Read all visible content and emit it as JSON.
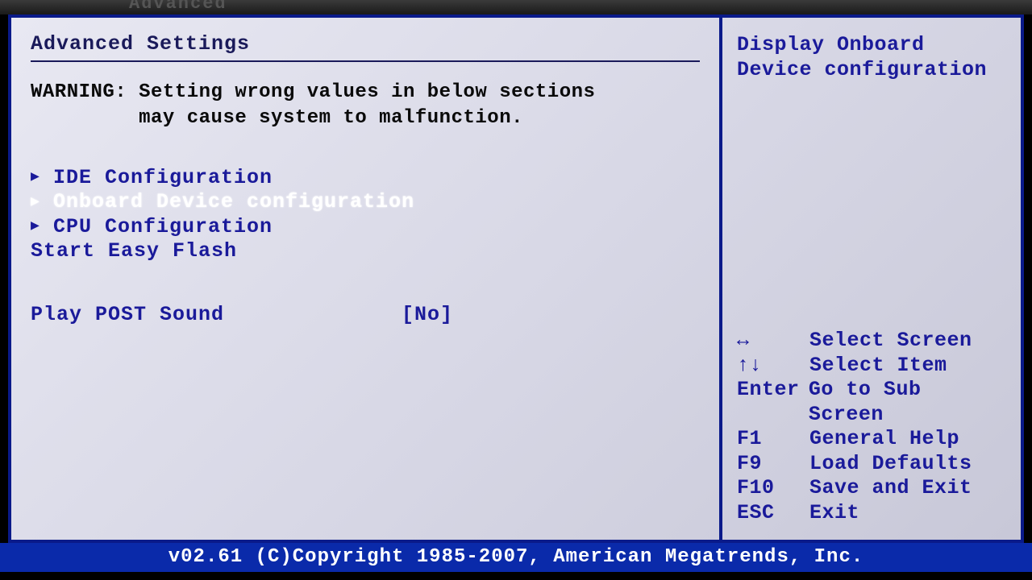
{
  "tab": {
    "label": "Advanced"
  },
  "main": {
    "title": "Advanced Settings",
    "warning": "WARNING: Setting wrong values in below sections\n         may cause system to malfunction.",
    "items": [
      {
        "label": "IDE Configuration",
        "submenu": true,
        "selected": false
      },
      {
        "label": "Onboard Device configuration",
        "submenu": true,
        "selected": true
      },
      {
        "label": "CPU Configuration",
        "submenu": true,
        "selected": false
      },
      {
        "label": "Start Easy Flash",
        "submenu": false,
        "selected": false
      }
    ],
    "option": {
      "label": "Play POST Sound",
      "value": "[No]"
    }
  },
  "help": {
    "text": "Display Onboard\nDevice configuration",
    "nav": [
      {
        "key": "↔",
        "action": "Select Screen"
      },
      {
        "key": "↑↓",
        "action": "Select Item"
      },
      {
        "key": "Enter",
        "action": "Go to Sub Screen"
      },
      {
        "key": "F1",
        "action": "General Help"
      },
      {
        "key": "F9",
        "action": "Load Defaults"
      },
      {
        "key": "F10",
        "action": "Save and Exit"
      },
      {
        "key": "ESC",
        "action": "Exit"
      }
    ]
  },
  "footer": "v02.61 (C)Copyright 1985-2007, American Megatrends, Inc."
}
